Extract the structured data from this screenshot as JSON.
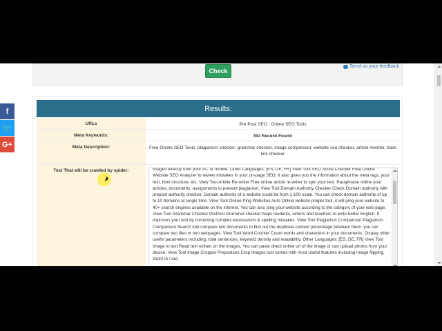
{
  "colors": {
    "check_button": "#2fa060",
    "results_header": "#2a6e8a",
    "label_cell": "#fcf4dc",
    "facebook": "#3b5998",
    "twitter": "#1da1f2",
    "google_plus": "#dd4b39"
  },
  "social": {
    "facebook_glyph": "f",
    "twitter_glyph": "🐦",
    "google_plus_glyph": "G+"
  },
  "form": {
    "check_label": "Check",
    "feedback_label": "Send us your feedback"
  },
  "results": {
    "title": "Results:",
    "rows": [
      {
        "label": "URLs",
        "value": "Pre Post SEO : Online SEO Tools"
      },
      {
        "label": "Meta Keywords:",
        "value": "NO Record Found"
      },
      {
        "label": "Meta Description:",
        "value": "Free Online SEO Tools: plagiarism checker, grammar checker, image compressor, website seo checker, article rewriter, back link checker"
      },
      {
        "label": "Text That will be crawled by spider:",
        "value": "images directly from your PC or mobile. Other Languages: [ES, DE, FR] View Tool SEO Score Checker Free Online Website SEO Analyzer to review mistakes in your on-page SEO. It also gives you the information about the meta tags, your text, html structure, etc. View Tool Article Re-writer Free online article re-writer to spin your text. Paraphrase online your articles, documents, assignments to prevent plagiarism. View Tool Domain Authority Checker Check Domain authority with prepost authority checker. Domain authority of a website could be from 1-100 scale. You can check domain authority of up to 10 domains at single time. View Tool Online Ping Websites Auto Online website pingler tool, it will ping your website to 40+ search engines available on the internet. You can also ping your website according to the category of your web page. View Tool Grammar Checker PrePost Grammar checker helps students, writers and teachers to write better English. It improves your text by correcting complex expressions & spelling mistakes. View Tool Plagiarism Comparison Plagiarism Comparison Search tool compare two documents to find out the duplicate content percentage between them. you can compare two files or two webpages. View Tool Word Counter Count words and characters in your documents. Display other useful parameters including, total sentences, keyword density and readability. Other Languages: [ES, DE, FR] View Tool Image to text Read text written on the images. You can paste direct online url of the image or can upload photos from your device. View Tool Image Cropper Prepostseo Crop images tool comes with most useful features including image flipping, zoom in / out,"
      }
    ]
  }
}
